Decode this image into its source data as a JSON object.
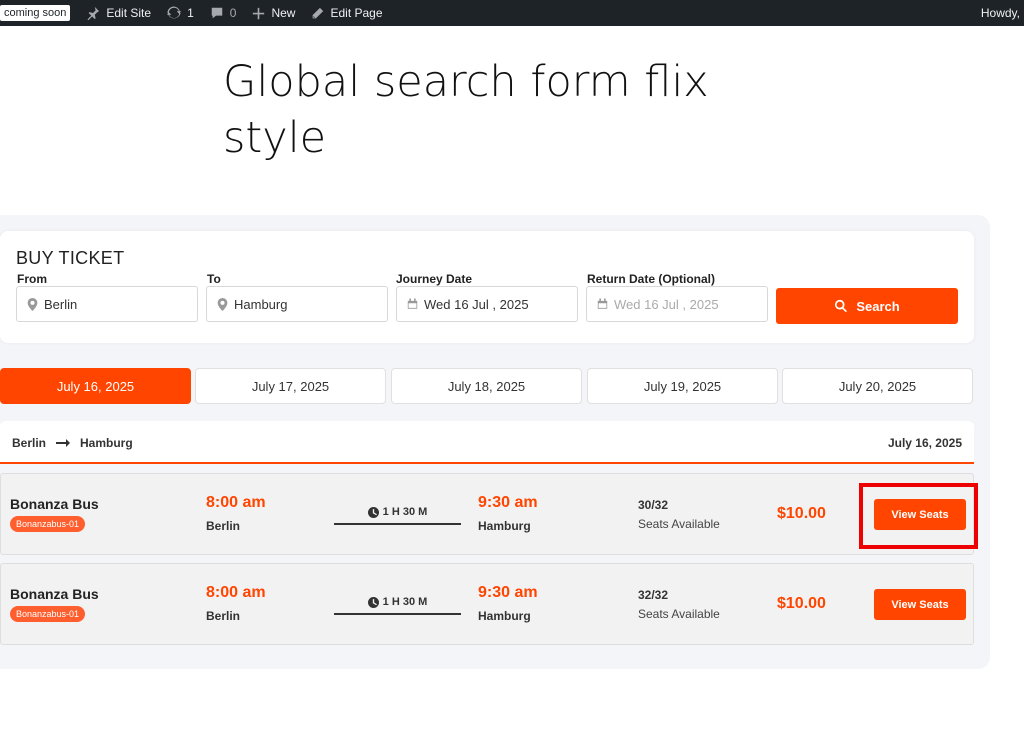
{
  "admin_bar": {
    "site_badge": "coming soon",
    "edit_site": "Edit Site",
    "updates_count": "1",
    "comments_count": "0",
    "new_label": "New",
    "edit_page": "Edit Page",
    "howdy": "Howdy,"
  },
  "page": {
    "title": "Global search form flix style"
  },
  "search": {
    "heading": "BUY TICKET",
    "from_label": "From",
    "from_value": "Berlin",
    "to_label": "To",
    "to_value": "Hamburg",
    "journey_label": "Journey Date",
    "journey_value": "Wed 16 Jul , 2025",
    "return_label": "Return Date (Optional)",
    "return_placeholder": "Wed 16 Jul , 2025",
    "button_label": "Search"
  },
  "date_tabs": [
    "July 16, 2025",
    "July 17, 2025",
    "July 18, 2025",
    "July 19, 2025",
    "July 20, 2025"
  ],
  "route": {
    "from": "Berlin",
    "to": "Hamburg",
    "date": "July 16, 2025"
  },
  "trips": [
    {
      "bus_name": "Bonanza Bus",
      "bus_tag": "Bonanzabus-01",
      "depart_time": "8:00 am",
      "depart_place": "Berlin",
      "duration": "1 H 30 M",
      "arrive_time": "9:30 am",
      "arrive_place": "Hamburg",
      "seats": "30/32",
      "seats_label": "Seats Available",
      "price": "$10.00",
      "button": "View Seats"
    },
    {
      "bus_name": "Bonanza Bus",
      "bus_tag": "Bonanzabus-01",
      "depart_time": "8:00 am",
      "depart_place": "Berlin",
      "duration": "1 H 30 M",
      "arrive_time": "9:30 am",
      "arrive_place": "Hamburg",
      "seats": "32/32",
      "seats_label": "Seats Available",
      "price": "$10.00",
      "button": "View Seats"
    }
  ],
  "colors": {
    "accent": "#ff4500",
    "admin_bar": "#1d2327",
    "highlight": "#ee0000"
  }
}
